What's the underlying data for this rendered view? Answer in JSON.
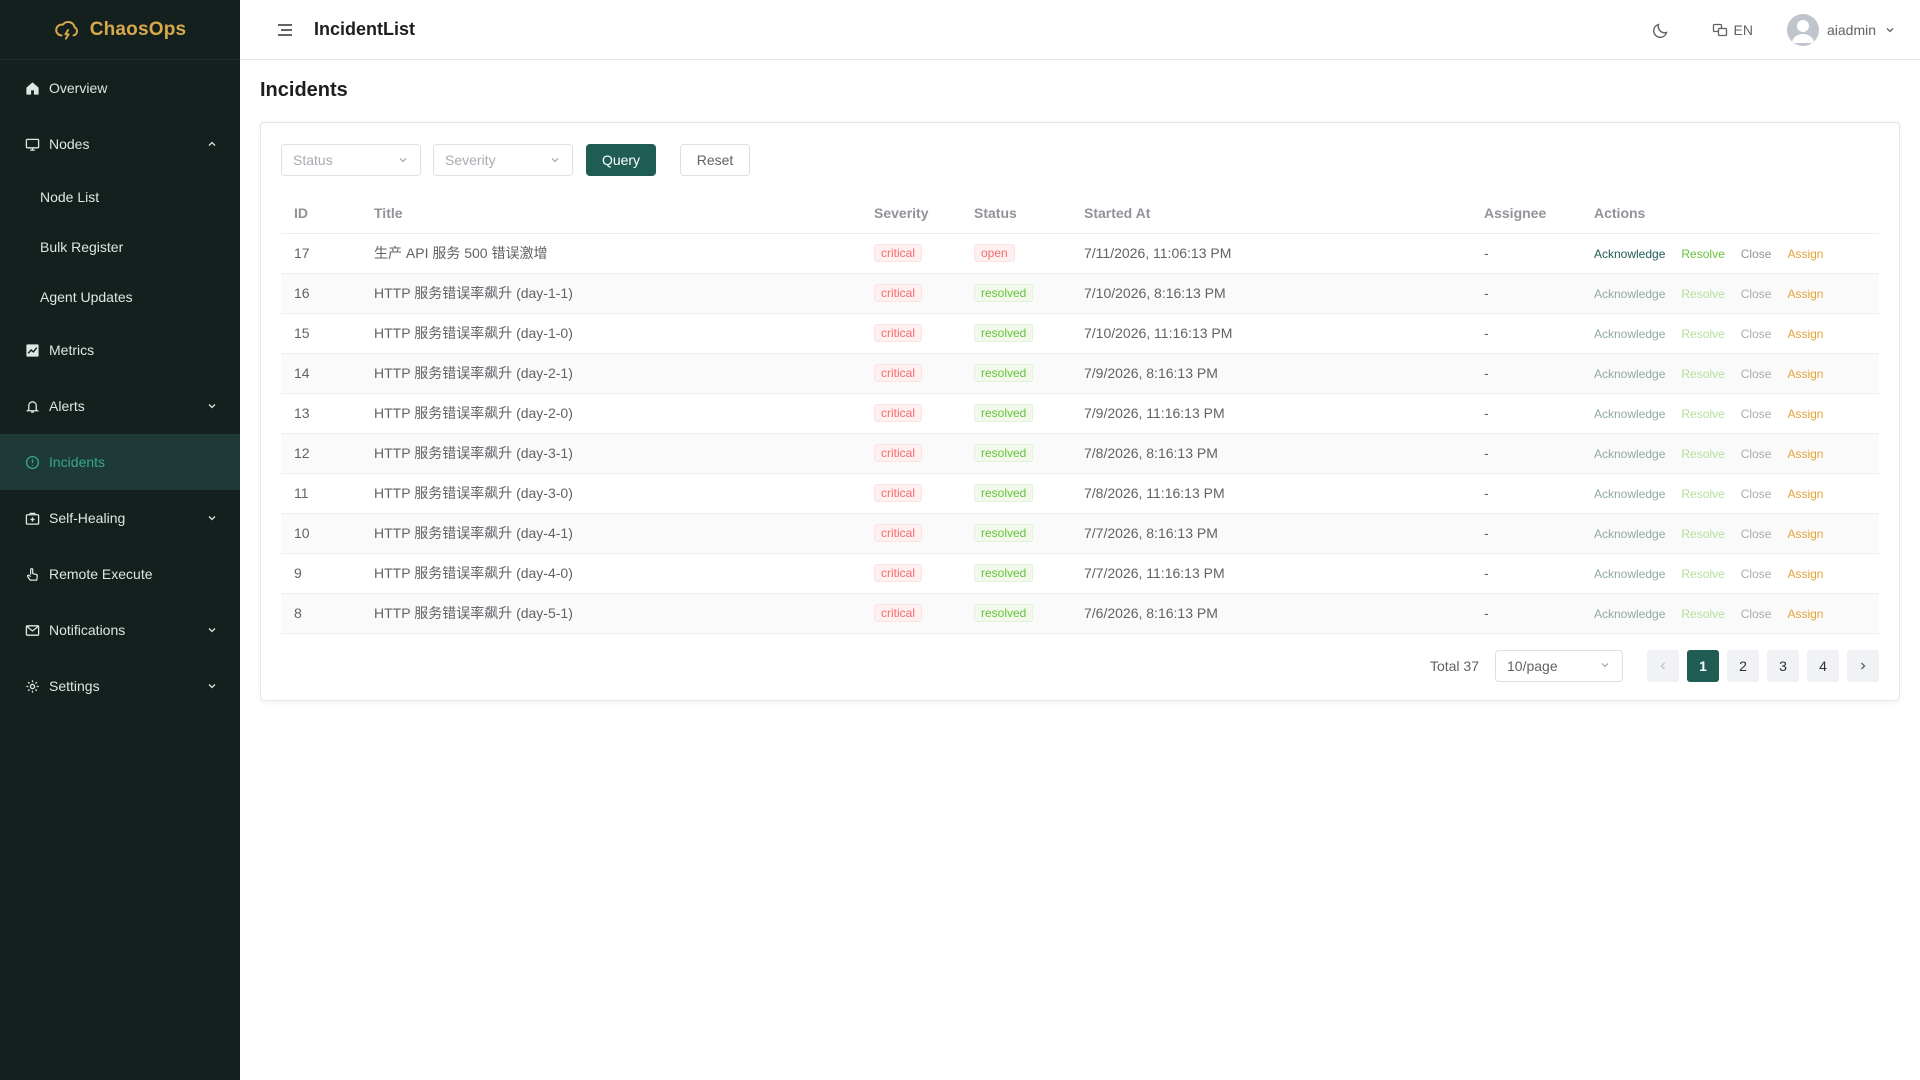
{
  "brand": {
    "name": "ChaosOps",
    "color": "#d8a94a"
  },
  "sidebar": {
    "items": [
      {
        "label": "Overview",
        "icon": "home-icon"
      },
      {
        "label": "Nodes",
        "icon": "monitor-icon",
        "expanded": true,
        "children": [
          {
            "label": "Node List"
          },
          {
            "label": "Bulk Register"
          },
          {
            "label": "Agent Updates"
          }
        ]
      },
      {
        "label": "Metrics",
        "icon": "chart-icon"
      },
      {
        "label": "Alerts",
        "icon": "bell-icon"
      },
      {
        "label": "Incidents",
        "icon": "warning-circle-icon",
        "active": true
      },
      {
        "label": "Self-Healing",
        "icon": "medkit-icon"
      },
      {
        "label": "Remote Execute",
        "icon": "pointer-icon"
      },
      {
        "label": "Notifications",
        "icon": "mail-icon"
      },
      {
        "label": "Settings",
        "icon": "gear-icon"
      }
    ]
  },
  "header": {
    "title": "IncidentList",
    "lang": "EN",
    "user": "aiadmin"
  },
  "page": {
    "title": "Incidents"
  },
  "filters": {
    "status_placeholder": "Status",
    "severity_placeholder": "Severity",
    "query_label": "Query",
    "reset_label": "Reset"
  },
  "table": {
    "columns": [
      "ID",
      "Title",
      "Severity",
      "Status",
      "Started At",
      "Assignee",
      "Actions"
    ],
    "action_labels": {
      "acknowledge": "Acknowledge",
      "resolve": "Resolve",
      "close": "Close",
      "assign": "Assign"
    },
    "rows": [
      {
        "id": "17",
        "title": "生产 API 服务 500 错误激增",
        "severity": "critical",
        "status": "open",
        "started_at": "7/11/2026, 11:06:13 PM",
        "assignee": "-"
      },
      {
        "id": "16",
        "title": "HTTP 服务错误率飙升 (day-1-1)",
        "severity": "critical",
        "status": "resolved",
        "started_at": "7/10/2026, 8:16:13 PM",
        "assignee": "-"
      },
      {
        "id": "15",
        "title": "HTTP 服务错误率飙升 (day-1-0)",
        "severity": "critical",
        "status": "resolved",
        "started_at": "7/10/2026, 11:16:13 PM",
        "assignee": "-"
      },
      {
        "id": "14",
        "title": "HTTP 服务错误率飙升 (day-2-1)",
        "severity": "critical",
        "status": "resolved",
        "started_at": "7/9/2026, 8:16:13 PM",
        "assignee": "-"
      },
      {
        "id": "13",
        "title": "HTTP 服务错误率飙升 (day-2-0)",
        "severity": "critical",
        "status": "resolved",
        "started_at": "7/9/2026, 11:16:13 PM",
        "assignee": "-"
      },
      {
        "id": "12",
        "title": "HTTP 服务错误率飙升 (day-3-1)",
        "severity": "critical",
        "status": "resolved",
        "started_at": "7/8/2026, 8:16:13 PM",
        "assignee": "-"
      },
      {
        "id": "11",
        "title": "HTTP 服务错误率飙升 (day-3-0)",
        "severity": "critical",
        "status": "resolved",
        "started_at": "7/8/2026, 11:16:13 PM",
        "assignee": "-"
      },
      {
        "id": "10",
        "title": "HTTP 服务错误率飙升 (day-4-1)",
        "severity": "critical",
        "status": "resolved",
        "started_at": "7/7/2026, 8:16:13 PM",
        "assignee": "-"
      },
      {
        "id": "9",
        "title": "HTTP 服务错误率飙升 (day-4-0)",
        "severity": "critical",
        "status": "resolved",
        "started_at": "7/7/2026, 11:16:13 PM",
        "assignee": "-"
      },
      {
        "id": "8",
        "title": "HTTP 服务错误率飙升 (day-5-1)",
        "severity": "critical",
        "status": "resolved",
        "started_at": "7/6/2026, 8:16:13 PM",
        "assignee": "-"
      }
    ]
  },
  "pagination": {
    "total_label": "Total 37",
    "page_size": "10/page",
    "pages": [
      "1",
      "2",
      "3",
      "4"
    ],
    "current": "1"
  },
  "colors": {
    "sidebar_bg": "#13201d",
    "primary": "#1f5c54",
    "active_text": "#3aa58e",
    "danger": "#f56c6c",
    "success": "#67c23a",
    "warning": "#e6a23c"
  }
}
